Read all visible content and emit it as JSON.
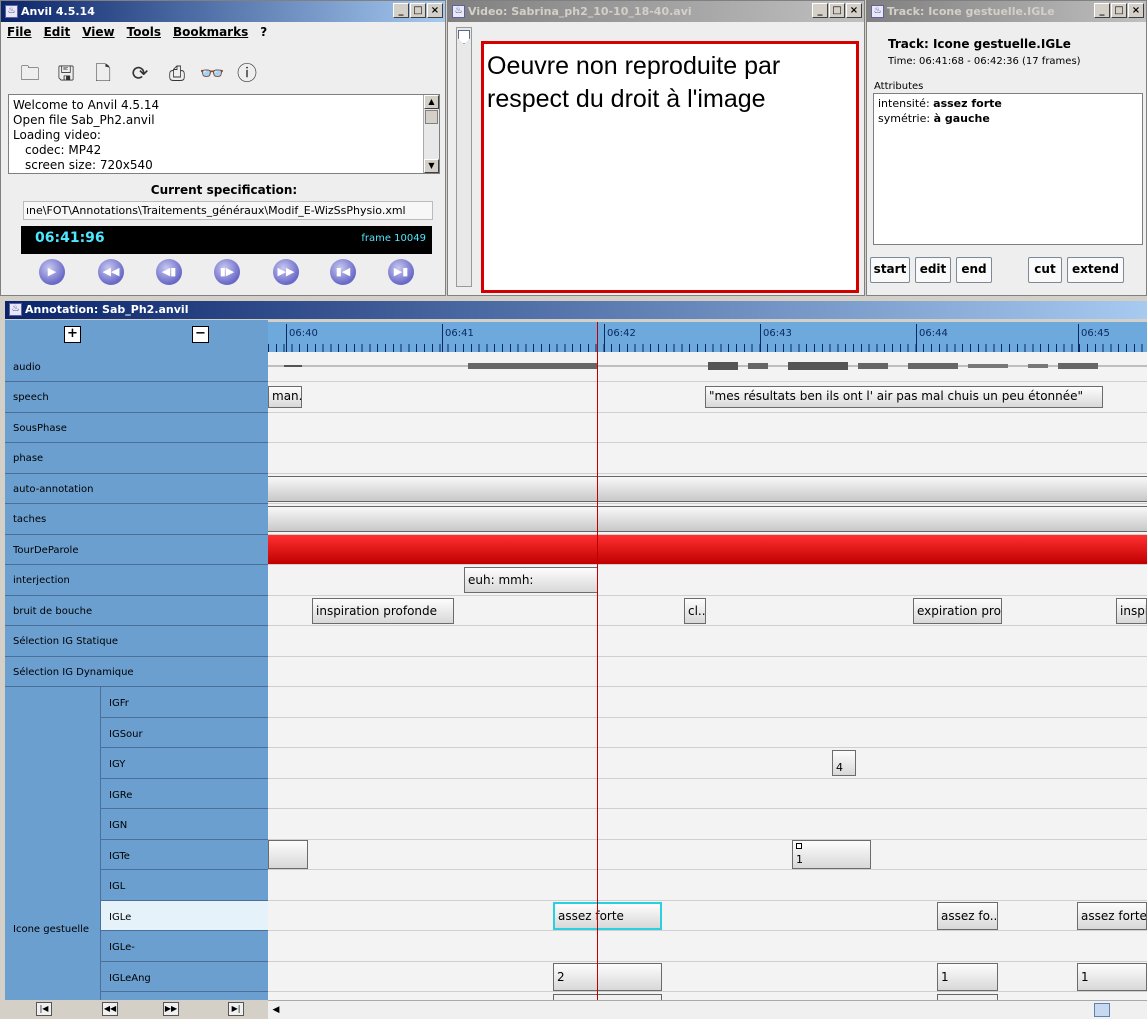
{
  "anvil_window": {
    "title": "Anvil 4.5.14",
    "menu": [
      "File",
      "Edit",
      "View",
      "Tools",
      "Bookmarks",
      "?"
    ],
    "toolbar_icons": [
      "open-folder-icon",
      "save-icon",
      "new-document-icon",
      "refresh-icon",
      "print-icon",
      "binoculars-icon",
      "info-icon"
    ],
    "log_lines": [
      "Welcome to Anvil 4.5.14",
      "Open file Sab_Ph2.anvil",
      "Loading video:",
      "   codec: MP42",
      "   screen size: 720x540"
    ],
    "spec_label": "Current specification:",
    "spec_path": "ıne\\FOT\\Annotations\\Traitements_généraux\\Modif_E-WizSsPhysio.xml",
    "time": "06:41:96",
    "frame": "frame 10049",
    "controls": [
      "▶",
      "◀◀",
      "◀▮",
      "▮▶",
      "▶▶",
      "▮◀",
      "▶▮"
    ]
  },
  "video_window": {
    "title": "Video: Sabrina_ph2_10-10_18-40.avi",
    "placeholder_text": "Oeuvre non reproduite par respect du droit à l'image"
  },
  "track_window": {
    "title": "Track: Icone gestuelle.IGLe",
    "header": "Track: Icone gestuelle.IGLe",
    "time_range": "Time: 06:41:68 - 06:42:36 (17 frames)",
    "attributes_label": "Attributes",
    "attributes": [
      {
        "name": "intensité:",
        "value": "assez forte"
      },
      {
        "name": "symétrie:",
        "value": "à gauche"
      }
    ],
    "buttons": {
      "start": "start",
      "edit": "edit",
      "end": "end",
      "cut": "cut",
      "extend": "extend"
    }
  },
  "annotation_window": {
    "title": "Annotation: Sab_Ph2.anvil",
    "plus": "+",
    "minus": "−",
    "ruler_ticks": [
      "06:40",
      "06:41",
      "06:42",
      "06:43",
      "06:44",
      "06:45"
    ],
    "tracks": [
      {
        "label": "audio"
      },
      {
        "label": "speech"
      },
      {
        "label": "SousPhase"
      },
      {
        "label": "phase"
      },
      {
        "label": "auto-annotation"
      },
      {
        "label": "taches"
      },
      {
        "label": "TourDeParole"
      },
      {
        "label": "interjection"
      },
      {
        "label": "bruit de bouche"
      },
      {
        "label": "Sélection IG Statique"
      },
      {
        "label": "Sélection IG Dynamique"
      }
    ],
    "group_label": "Icone gestuelle",
    "subtracks": [
      "IGFr",
      "IGSour",
      "IGY",
      "IGRe",
      "IGN",
      "IGTe",
      "IGL",
      "IGLe",
      "IGLe-",
      "IGLeAng"
    ],
    "elements": {
      "speech_1": "man..",
      "speech_2": "\"mes résultats ben ils ont l' air pas mal chuis un peu étonnée\"",
      "interjection_1": "euh: mmh:",
      "bruit_1": "inspiration profonde",
      "bruit_2": "cl..",
      "bruit_3": "expiration pro..",
      "bruit_4": "inspi",
      "igy_1": "4",
      "igte_2": "1",
      "igle_1": "assez forte",
      "igle_2": "assez fo..",
      "igle_3": "assez forte",
      "igleang_1": "2",
      "igleang_2": "1",
      "igleang_3": "1"
    },
    "nav_buttons": [
      "|◀",
      "◀◀",
      "▶▶",
      "▶|"
    ]
  }
}
